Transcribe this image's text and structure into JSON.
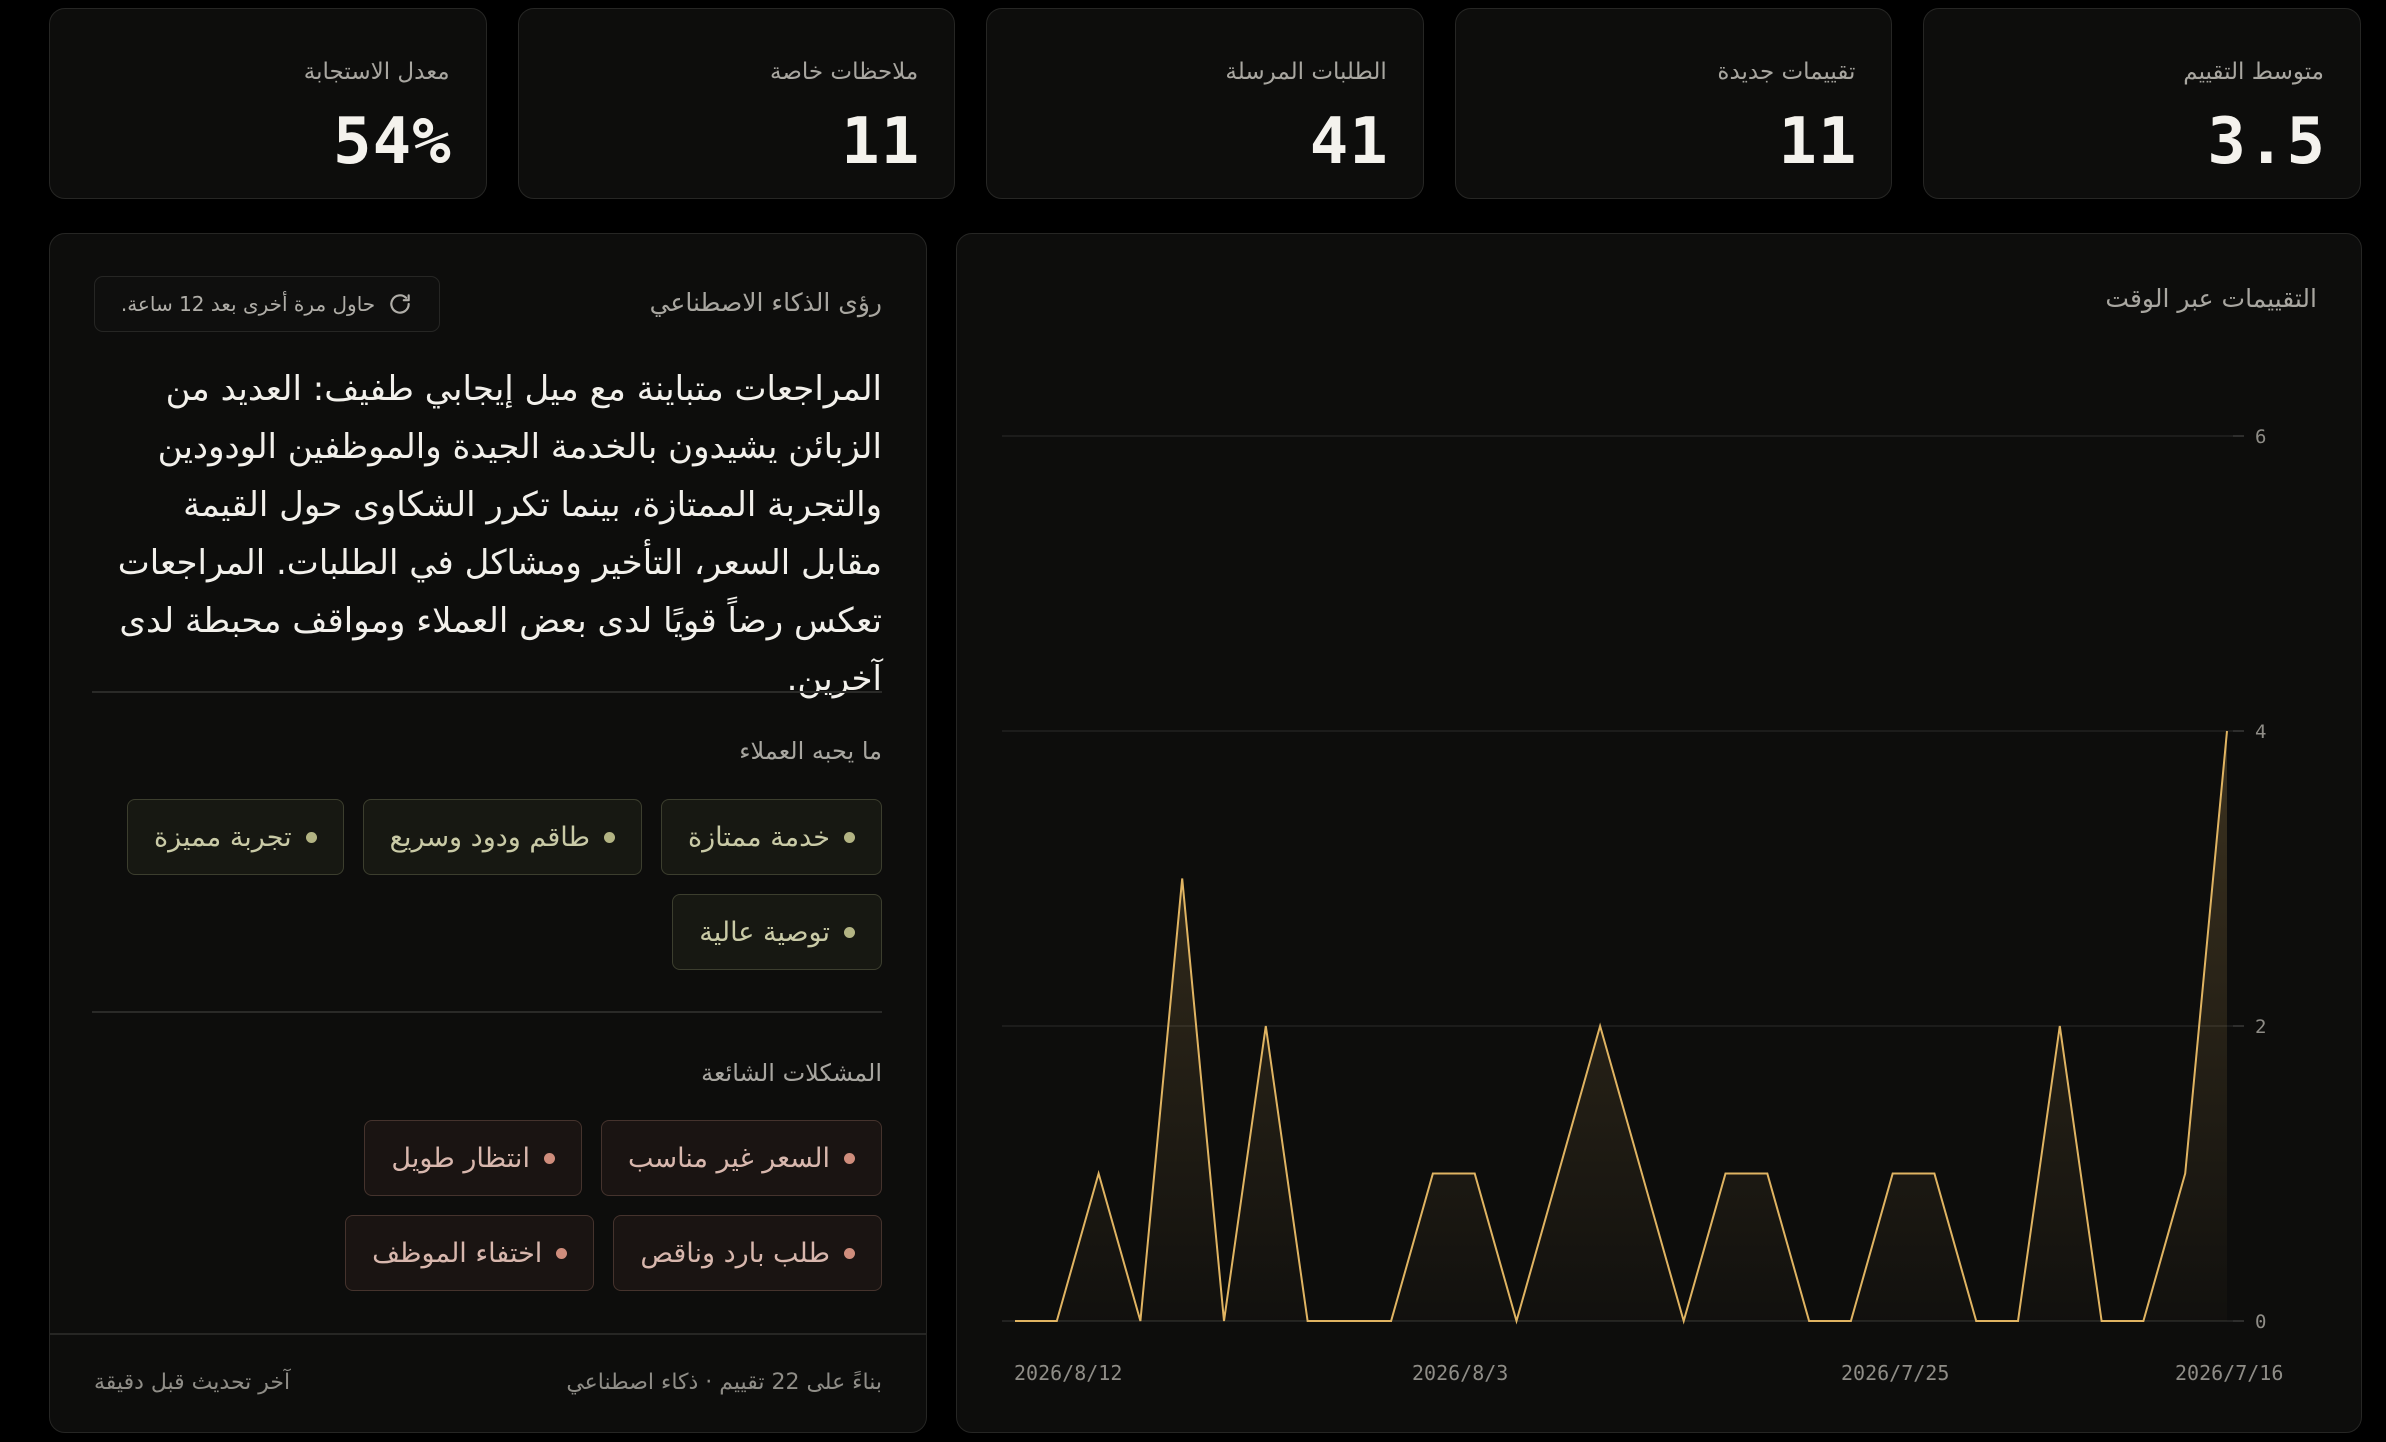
{
  "stats": [
    {
      "label": "متوسط التقييم",
      "value": "3.5"
    },
    {
      "label": "تقييمات جديدة",
      "value": "11"
    },
    {
      "label": "الطلبات المرسلة",
      "value": "41"
    },
    {
      "label": "ملاحظات خاصة",
      "value": "11"
    },
    {
      "label": "معدل الاستجابة",
      "value": "54%"
    }
  ],
  "chart": {
    "title": "التقييمات عبر الوقت"
  },
  "chart_data": {
    "type": "area",
    "title": "التقييمات عبر الوقت",
    "xlabel": "",
    "ylabel": "",
    "ylim": [
      0,
      6
    ],
    "yticks": [
      0,
      2,
      4,
      6
    ],
    "xticks": [
      "2026/7/16",
      "2026/7/25",
      "2026/8/3",
      "2026/8/12"
    ],
    "x_order": "right-to-left",
    "grid": true,
    "color": "#e0b462",
    "values": [
      4,
      1,
      0,
      0,
      2,
      0,
      0,
      1,
      1,
      0,
      0,
      1,
      1,
      0,
      1,
      2,
      1,
      0,
      1,
      1,
      0,
      0,
      0,
      2,
      0,
      3,
      0,
      1,
      0,
      0
    ]
  },
  "insights": {
    "title": "رؤى الذكاء الاصطناعي",
    "retry_label": "حاول مرة أخرى بعد 12 ساعة.",
    "summary": "المراجعات متباينة مع ميل إيجابي طفيف: العديد من الزبائن يشيدون بالخدمة الجيدة والموظفين الودودين والتجربة الممتازة، بينما تكرر الشكاوى حول القيمة مقابل السعر، التأخير ومشاكل في الطلبات. المراجعات تعكس رضاً قويًا لدى بعض العملاء ومواقف محبطة لدى آخرين.",
    "loves_title": "ما يحبه العملاء",
    "loves": [
      "خدمة ممتازة",
      "طاقم ودود وسريع",
      "تجربة مميزة",
      "توصية عالية"
    ],
    "issues_title": "المشكلات الشائعة",
    "issues": [
      "السعر غير مناسب",
      "انتظار طويل",
      "طلب بارد وناقص",
      "اختفاء الموظف"
    ],
    "footer_basis": "بناءً على 22 تقييم · ذكاء اصطناعي",
    "footer_updated": "آخر تحديث قبل دقيقة"
  },
  "colors": {
    "accent": "#e0b462",
    "love": "#b3b483",
    "issue": "#cf8d7c"
  }
}
